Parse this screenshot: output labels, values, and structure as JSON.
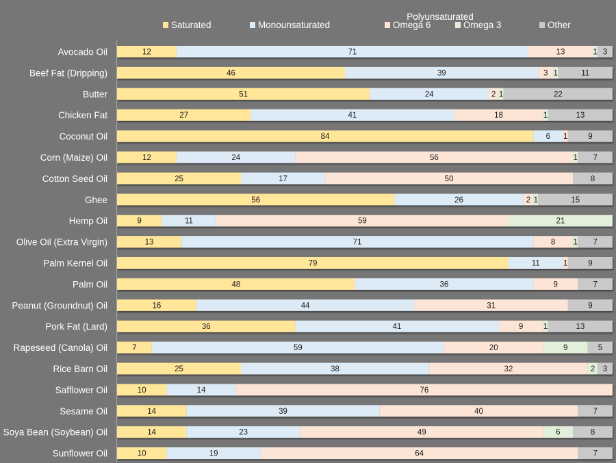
{
  "chart_data": {
    "type": "bar",
    "orientation": "horizontal",
    "stacked": true,
    "units": "percent",
    "title": "",
    "xlabel": "",
    "ylabel": "",
    "xlim": [
      0,
      100
    ],
    "grid": false,
    "legend": {
      "position": "top",
      "group_title": "Polyunsaturated",
      "group_title_over": [
        "Omega 6",
        "Omega 3"
      ]
    },
    "categories": [
      "Avocado Oil",
      "Beef Fat (Dripping)",
      "Butter",
      "Chicken Fat",
      "Coconut Oil",
      "Corn (Maize) Oil",
      "Cotton Seed Oil",
      "Ghee",
      "Hemp Oil",
      "Olive Oil (Extra Virgin)",
      "Palm Kernel Oil",
      "Palm Oil",
      "Peanut (Groundnut) Oil",
      "Pork Fat (Lard)",
      "Rapeseed (Canola) Oil",
      "Rice Barn Oil",
      "Safflower Oil",
      "Sesame Oil",
      "Soya Bean (Soybean) Oil",
      "Sunflower Oil"
    ],
    "series": [
      {
        "name": "Saturated",
        "color": "#ffe699",
        "values": [
          12,
          46,
          51,
          27,
          84,
          12,
          25,
          56,
          9,
          13,
          79,
          48,
          16,
          36,
          7,
          25,
          10,
          14,
          14,
          10
        ]
      },
      {
        "name": "Monounsaturated",
        "color": "#ddebf7",
        "values": [
          71,
          39,
          24,
          41,
          6,
          24,
          17,
          26,
          11,
          71,
          11,
          36,
          44,
          41,
          59,
          38,
          14,
          39,
          23,
          19
        ]
      },
      {
        "name": "Omega 6",
        "color": "#fce4d6",
        "values": [
          13,
          3,
          2,
          18,
          1,
          56,
          50,
          2,
          59,
          8,
          1,
          9,
          31,
          9,
          20,
          32,
          76,
          40,
          49,
          64
        ]
      },
      {
        "name": "Omega 3",
        "color": "#e2efda",
        "values": [
          1,
          1,
          1,
          1,
          0,
          1,
          0,
          1,
          21,
          1,
          0,
          0,
          0,
          1,
          9,
          2,
          0,
          0,
          6,
          0
        ]
      },
      {
        "name": "Other",
        "color": "#c9c9c9",
        "values": [
          3,
          11,
          22,
          13,
          9,
          7,
          8,
          15,
          0,
          7,
          9,
          7,
          9,
          13,
          5,
          3,
          0,
          7,
          8,
          7
        ]
      }
    ]
  },
  "colors": {
    "background": "#767676",
    "axis": "#a6a6a6",
    "label_text": "#ffffff",
    "value_text": "#1a1a1a"
  }
}
